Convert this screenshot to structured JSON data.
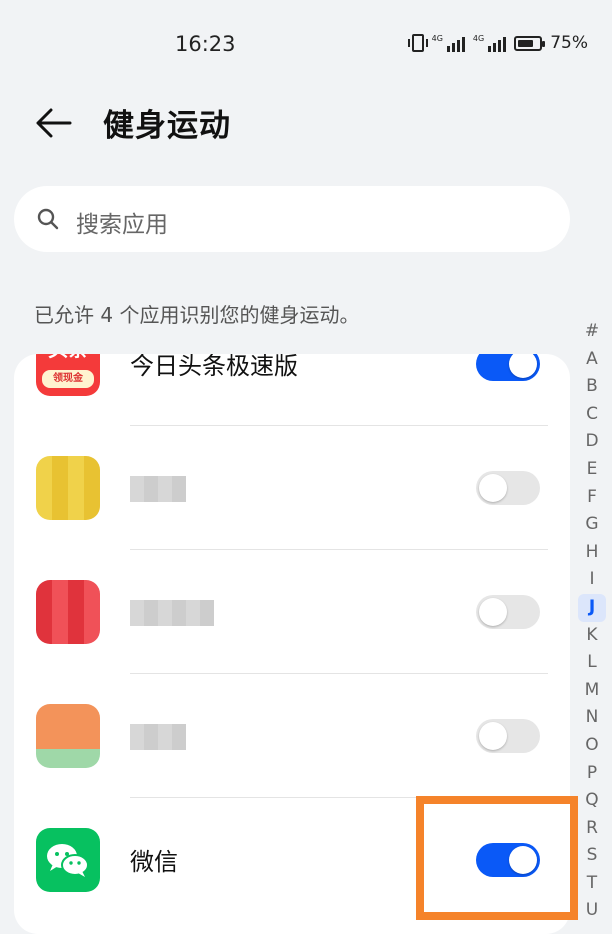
{
  "status_bar": {
    "time": "16:23",
    "network_1": "4G",
    "network_2": "4G",
    "battery_level": 0.75,
    "battery_text": "75%"
  },
  "header": {
    "title": "健身运动"
  },
  "search": {
    "placeholder": "搜索应用"
  },
  "permission": {
    "description": "已允许 4 个应用识别您的健身运动。"
  },
  "apps": [
    {
      "name": "今日头条极速版",
      "enabled": true,
      "icon": "toutiao-lite-icon",
      "icon_text_top": "头条",
      "icon_text_bottom": "领现金"
    },
    {
      "name": "",
      "enabled": false,
      "icon": "blurred-app-icon"
    },
    {
      "name": "",
      "enabled": false,
      "icon": "blurred-app-icon"
    },
    {
      "name": "",
      "enabled": false,
      "icon": "blurred-app-icon"
    },
    {
      "name": "微信",
      "enabled": true,
      "icon": "wechat-icon"
    }
  ],
  "index_bar": {
    "letters": [
      "#",
      "A",
      "B",
      "C",
      "D",
      "E",
      "F",
      "G",
      "H",
      "I",
      "J",
      "K",
      "L",
      "M",
      "N",
      "O",
      "P",
      "Q",
      "R",
      "S",
      "T",
      "U"
    ],
    "active": "J"
  },
  "colors": {
    "accent": "#0a59f7",
    "highlight": "#f5832a",
    "background": "#f1f3f5"
  }
}
